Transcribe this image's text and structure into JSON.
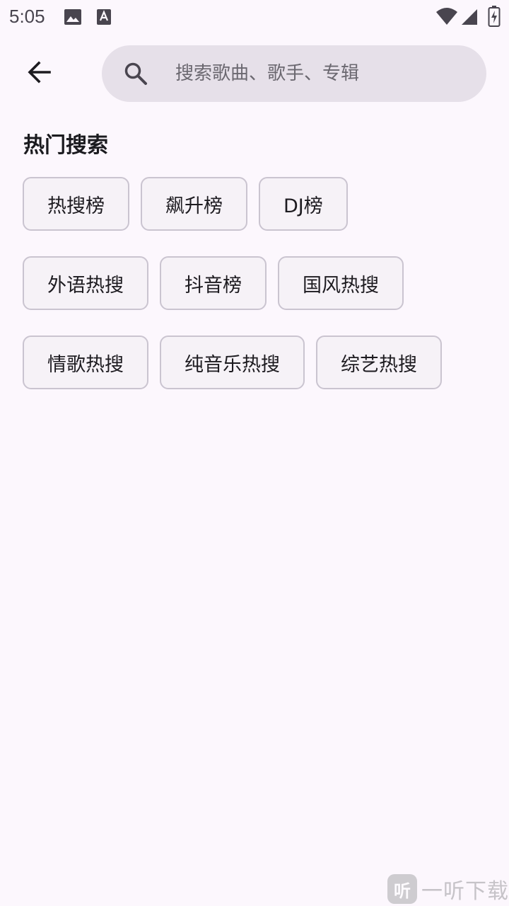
{
  "status_bar": {
    "time": "5:05",
    "icons": [
      "image-icon",
      "font-download-icon",
      "wifi-icon",
      "signal-icon",
      "battery-charging-icon"
    ]
  },
  "top_bar": {
    "back_icon": "arrow-left-icon",
    "search": {
      "icon": "search-icon",
      "placeholder": "搜索歌曲、歌手、专辑",
      "value": ""
    }
  },
  "hot_search": {
    "title": "热门搜索",
    "rows": [
      [
        "热搜榜",
        "飙升榜",
        "DJ榜"
      ],
      [
        "外语热搜",
        "抖音榜",
        "国风热搜"
      ],
      [
        "情歌热搜",
        "纯音乐热搜",
        "综艺热搜"
      ]
    ]
  },
  "watermark": {
    "logo_text": "听",
    "text": "一听下载"
  },
  "colors": {
    "background": "#fcf7fd",
    "search_bar": "#e6e0e9",
    "chip_border": "#cac4d0",
    "chip_background": "#f6f2f7"
  }
}
